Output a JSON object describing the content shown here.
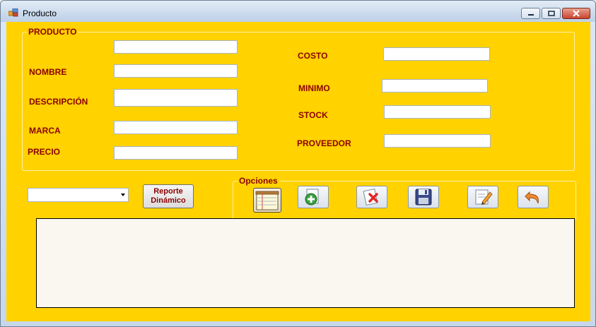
{
  "window": {
    "title": "Producto"
  },
  "producto": {
    "group_title": "PRODUCTO",
    "labels": {
      "nombre": "NOMBRE",
      "descripcion": "DESCRIPCIÓN",
      "marca": "MARCA",
      "precio": "PRECIO",
      "costo": "COSTO",
      "minimo": "MINIMO",
      "stock": "STOCK",
      "proveedor": "PROVEEDOR"
    },
    "fields": {
      "codigo": "",
      "nombre": "",
      "descripcion": "",
      "marca": "",
      "precio": "",
      "costo": "",
      "minimo": "",
      "stock": "",
      "proveedor": ""
    }
  },
  "toolbar": {
    "combo_value": "",
    "report_label_line1": "Reporte",
    "report_label_line2": "Dinámico"
  },
  "opciones": {
    "group_title": "Opciones",
    "buttons": [
      {
        "name": "list-button",
        "icon": "notepad-icon"
      },
      {
        "name": "add-button",
        "icon": "add-icon"
      },
      {
        "name": "delete-button",
        "icon": "delete-icon"
      },
      {
        "name": "save-button",
        "icon": "floppy-disk-icon"
      },
      {
        "name": "edit-button",
        "icon": "edit-icon"
      },
      {
        "name": "undo-button",
        "icon": "undo-arrow-icon"
      }
    ]
  },
  "colors": {
    "form_background": "#ffd200",
    "label_text": "#8b0000",
    "grid_background": "#faf7f0"
  }
}
